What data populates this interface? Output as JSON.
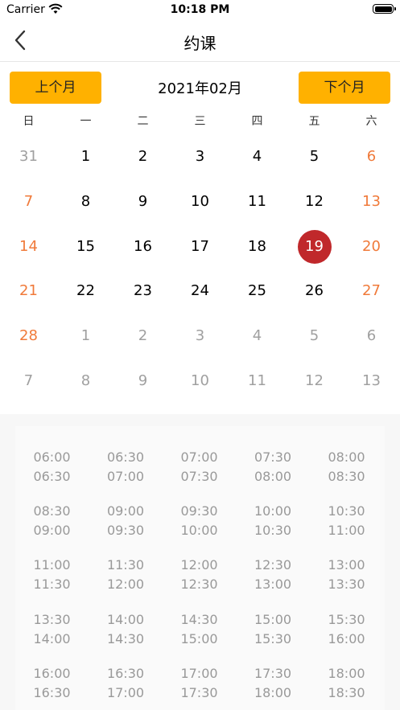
{
  "status_bar": {
    "carrier": "Carrier",
    "time": "10:18 PM"
  },
  "navbar": {
    "title": "约课"
  },
  "calendar": {
    "prev_label": "上个月",
    "next_label": "下个月",
    "month": "2021年02月",
    "weekdays": [
      "日",
      "一",
      "二",
      "三",
      "四",
      "五",
      "六"
    ],
    "days": [
      {
        "d": "31",
        "t": "other"
      },
      {
        "d": "1",
        "t": "normal"
      },
      {
        "d": "2",
        "t": "normal"
      },
      {
        "d": "3",
        "t": "normal"
      },
      {
        "d": "4",
        "t": "normal"
      },
      {
        "d": "5",
        "t": "normal"
      },
      {
        "d": "6",
        "t": "weekend"
      },
      {
        "d": "7",
        "t": "weekend"
      },
      {
        "d": "8",
        "t": "normal"
      },
      {
        "d": "9",
        "t": "normal"
      },
      {
        "d": "10",
        "t": "normal"
      },
      {
        "d": "11",
        "t": "normal"
      },
      {
        "d": "12",
        "t": "normal"
      },
      {
        "d": "13",
        "t": "weekend"
      },
      {
        "d": "14",
        "t": "weekend"
      },
      {
        "d": "15",
        "t": "normal"
      },
      {
        "d": "16",
        "t": "normal"
      },
      {
        "d": "17",
        "t": "normal"
      },
      {
        "d": "18",
        "t": "normal"
      },
      {
        "d": "19",
        "t": "selected"
      },
      {
        "d": "20",
        "t": "weekend"
      },
      {
        "d": "21",
        "t": "weekend"
      },
      {
        "d": "22",
        "t": "normal"
      },
      {
        "d": "23",
        "t": "normal"
      },
      {
        "d": "24",
        "t": "normal"
      },
      {
        "d": "25",
        "t": "normal"
      },
      {
        "d": "26",
        "t": "normal"
      },
      {
        "d": "27",
        "t": "weekend"
      },
      {
        "d": "28",
        "t": "weekend"
      },
      {
        "d": "1",
        "t": "other"
      },
      {
        "d": "2",
        "t": "other"
      },
      {
        "d": "3",
        "t": "other"
      },
      {
        "d": "4",
        "t": "other"
      },
      {
        "d": "5",
        "t": "other"
      },
      {
        "d": "6",
        "t": "other"
      },
      {
        "d": "7",
        "t": "other"
      },
      {
        "d": "8",
        "t": "other"
      },
      {
        "d": "9",
        "t": "other"
      },
      {
        "d": "10",
        "t": "other"
      },
      {
        "d": "11",
        "t": "other"
      },
      {
        "d": "12",
        "t": "other"
      },
      {
        "d": "13",
        "t": "other"
      }
    ]
  },
  "time_slots": [
    {
      "start": "06:00",
      "end": "06:30"
    },
    {
      "start": "06:30",
      "end": "07:00"
    },
    {
      "start": "07:00",
      "end": "07:30"
    },
    {
      "start": "07:30",
      "end": "08:00"
    },
    {
      "start": "08:00",
      "end": "08:30"
    },
    {
      "start": "08:30",
      "end": "09:00"
    },
    {
      "start": "09:00",
      "end": "09:30"
    },
    {
      "start": "09:30",
      "end": "10:00"
    },
    {
      "start": "10:00",
      "end": "10:30"
    },
    {
      "start": "10:30",
      "end": "11:00"
    },
    {
      "start": "11:00",
      "end": "11:30"
    },
    {
      "start": "11:30",
      "end": "12:00"
    },
    {
      "start": "12:00",
      "end": "12:30"
    },
    {
      "start": "12:30",
      "end": "13:00"
    },
    {
      "start": "13:00",
      "end": "13:30"
    },
    {
      "start": "13:30",
      "end": "14:00"
    },
    {
      "start": "14:00",
      "end": "14:30"
    },
    {
      "start": "14:30",
      "end": "15:00"
    },
    {
      "start": "15:00",
      "end": "15:30"
    },
    {
      "start": "15:30",
      "end": "16:00"
    },
    {
      "start": "16:00",
      "end": "16:30"
    },
    {
      "start": "16:30",
      "end": "17:00"
    },
    {
      "start": "17:00",
      "end": "17:30"
    },
    {
      "start": "17:30",
      "end": "18:00"
    },
    {
      "start": "18:00",
      "end": "18:30"
    }
  ],
  "colors": {
    "accent": "#ffb100",
    "selected": "#c0282b",
    "weekend": "#f07a3a",
    "muted": "#a0a0a0"
  }
}
